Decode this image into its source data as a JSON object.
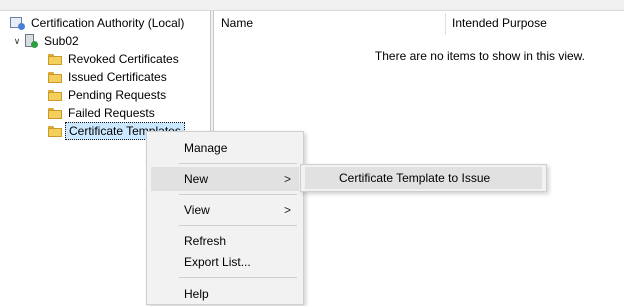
{
  "tree": {
    "root_label": "Certification Authority (Local)",
    "server_label": "Sub02",
    "items": [
      {
        "label": "Revoked Certificates"
      },
      {
        "label": "Issued Certificates"
      },
      {
        "label": "Pending Requests"
      },
      {
        "label": "Failed Requests"
      },
      {
        "label": "Certificate Templates"
      }
    ]
  },
  "list_view": {
    "columns": [
      "Name",
      "Intended Purpose"
    ],
    "empty_message": "There are no items to show in this view."
  },
  "context_menu": {
    "items": {
      "manage": "Manage",
      "new": "New",
      "view": "View",
      "refresh": "Refresh",
      "export": "Export List...",
      "help": "Help"
    },
    "arrow_glyph": ">"
  },
  "submenu": {
    "item": "Certificate Template to Issue"
  },
  "icons": {
    "folder": "folder-icon",
    "ca": "certification-authority-icon",
    "server": "server-icon",
    "expand": "chevron-down-icon"
  },
  "colors": {
    "selection": "#cce8ff",
    "menu_background": "#f2f2f2",
    "menu_highlight": "#e1e1e1",
    "folder": "#f5cf5c"
  }
}
